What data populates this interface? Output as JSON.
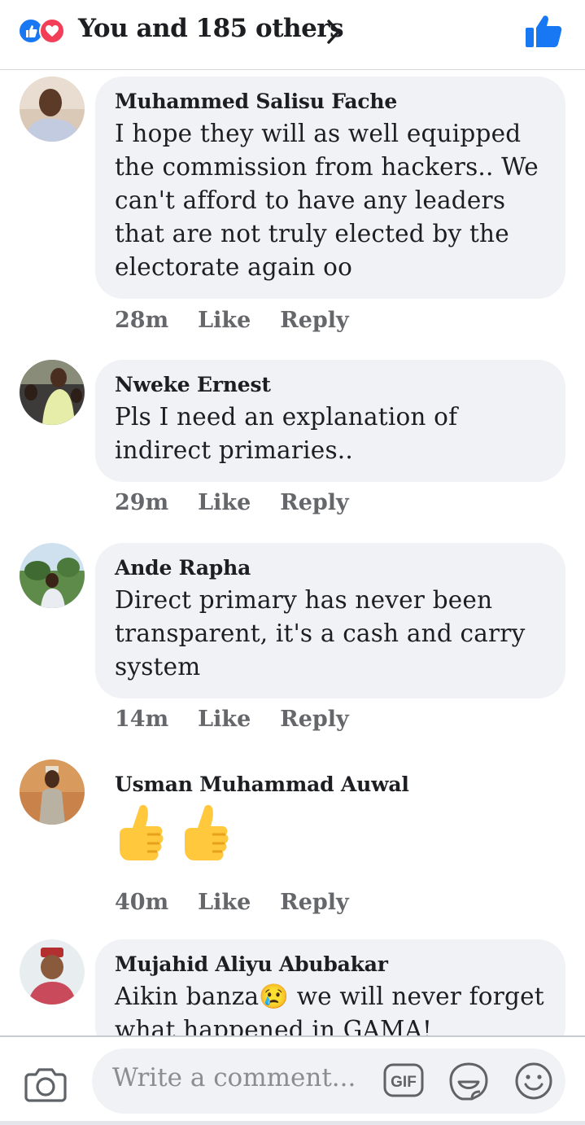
{
  "header": {
    "reactions_text": "You and 185 others",
    "reaction_icons": [
      "like-reaction-icon",
      "love-reaction-icon"
    ],
    "accent_color": "#1877f2",
    "love_color": "#f33e58"
  },
  "comments": [
    {
      "author": "Muhammed Salisu Fache",
      "text": "I hope they will as well equipped the commission from hackers.. We can't afford to have any leaders that are not truly elected by the electorate again oo",
      "time": "28m",
      "like": "Like",
      "reply": "Reply"
    },
    {
      "author": "Nweke Ernest",
      "text": "Pls I need an explanation of indirect primaries..",
      "time": "29m",
      "like": "Like",
      "reply": "Reply"
    },
    {
      "author": "Ande Rapha",
      "text": "Direct primary has never been transparent, it's a cash and carry system",
      "time": "14m",
      "like": "Like",
      "reply": "Reply"
    },
    {
      "author": "Usman Muhammad Auwal",
      "text": "",
      "emojis": [
        "thumbs-up-emoji",
        "thumbs-up-emoji"
      ],
      "time": "40m",
      "like": "Like",
      "reply": "Reply"
    },
    {
      "author": "Mujahid Aliyu Abubakar",
      "text": "Aikin banza😢 we will never forget what happened in GAMA!",
      "time": "",
      "like": "",
      "reply": ""
    }
  ],
  "composer": {
    "placeholder": "Write a comment...",
    "gif_label": "GIF",
    "icons": [
      "camera-icon",
      "gif-icon",
      "sticker-icon",
      "emoji-icon"
    ]
  }
}
